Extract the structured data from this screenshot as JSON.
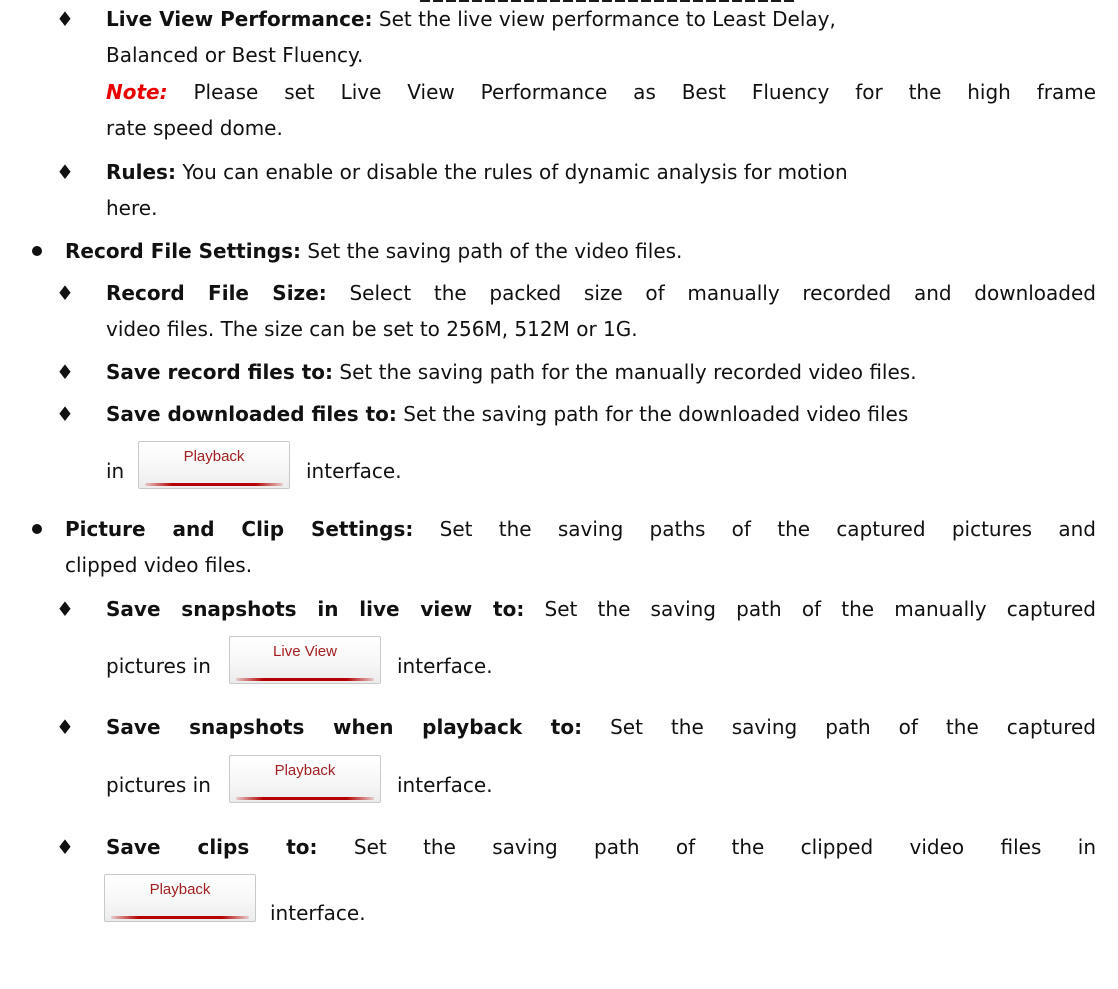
{
  "glyphs": {
    "diamond": "♦"
  },
  "live_view_performance": {
    "label": "Live View Performance:",
    "text1": " Set the live view performance to Least Delay,",
    "text2": "Balanced or Best Fluency."
  },
  "note": {
    "label": "Note:",
    "text1": " Please set Live View Performance as Best Fluency for the high frame",
    "text2": "rate speed dome."
  },
  "rules": {
    "label": "Rules:",
    "text1": " You can enable or disable the rules of dynamic analysis for motion",
    "text2": "here."
  },
  "record_file_settings": {
    "label": "Record File Settings:",
    "text": " Set the saving path of the video files."
  },
  "record_file_size": {
    "label": "Record File Size:",
    "text1": " Select the packed size of manually recorded and downloaded",
    "text2": "video files. The size can be set to 256M, 512M or 1G."
  },
  "save_record_files": {
    "label": "Save record files to:",
    "text": " Set the saving path for the manually recorded video files."
  },
  "save_downloaded_files": {
    "label": "Save downloaded files to:",
    "text": " Set the saving path for the downloaded video files",
    "pre": "in",
    "post": "interface."
  },
  "picture_clip_settings": {
    "label": "Picture and Clip Settings:",
    "text1": " Set the saving paths of the captured pictures and",
    "text2": "clipped video files."
  },
  "save_snapshots_live": {
    "label": "Save snapshots in live view to:",
    "text": " Set the saving path of the manually captured",
    "pre": "pictures in",
    "post": "interface."
  },
  "save_snapshots_playback": {
    "label": "Save snapshots when playback to:",
    "text": " Set the saving path of the captured",
    "pre": "pictures in",
    "post": "interface."
  },
  "save_clips": {
    "label": "Save clips to:",
    "text": " Set the saving path of the clipped video files in",
    "post": "interface."
  },
  "buttons": {
    "playback": "Playback",
    "live_view": "Live View"
  }
}
